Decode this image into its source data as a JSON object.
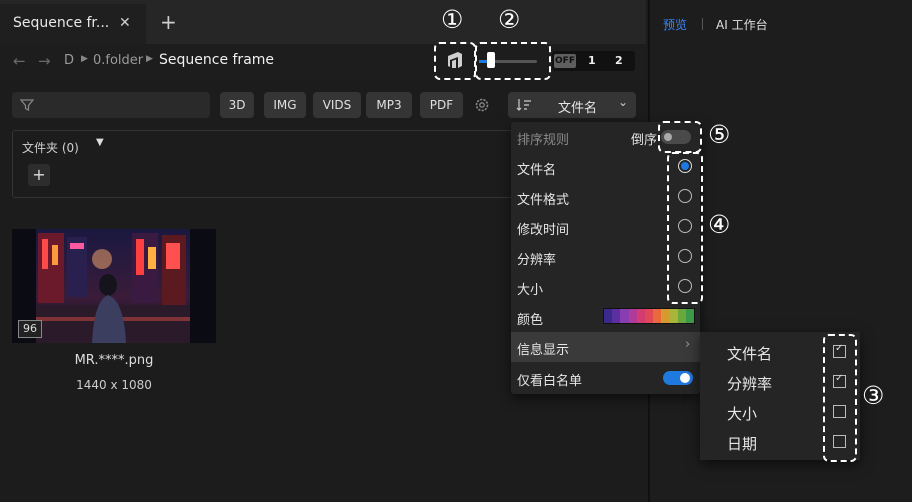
{
  "tab": {
    "title": "Sequence fr...",
    "close": "✕",
    "add": "+"
  },
  "path": {
    "back": "←",
    "forward": "→",
    "crumbs": [
      "D",
      "0.folder"
    ],
    "current": "Sequence frame"
  },
  "toggle": {
    "off": "OFF",
    "opt1": "1",
    "opt2": "2"
  },
  "filter_buttons": [
    "3D",
    "IMG",
    "VIDS",
    "MP3",
    "PDF"
  ],
  "sort": {
    "label": "文件名"
  },
  "folder": {
    "label": "文件夹 (0)",
    "add": "+"
  },
  "thumbnail": {
    "badge": "96",
    "name": "MR.****.png",
    "resolution": "1440 x 1080"
  },
  "right_panel": {
    "tab_preview": "预览",
    "tab_ai": "AI 工作台"
  },
  "dropdown": {
    "header": "排序规则",
    "reverse_label": "倒序",
    "reverse_on": false,
    "options": [
      "文件名",
      "文件格式",
      "修改时间",
      "分辨率",
      "大小"
    ],
    "selected_index": 0,
    "color_label": "颜色",
    "color_swatches": [
      "#3b2a8c",
      "#5a2fa0",
      "#8a3db0",
      "#b03a9a",
      "#d23c6e",
      "#e0485a",
      "#e86a3a",
      "#d89a30",
      "#a8b43a",
      "#6aa83a",
      "#3a9a4a"
    ],
    "info_label": "信息显示",
    "whitelist_label": "仅看白名单",
    "whitelist_on": true
  },
  "submenu": {
    "items": [
      {
        "label": "文件名",
        "checked": true
      },
      {
        "label": "分辨率",
        "checked": true
      },
      {
        "label": "大小",
        "checked": false
      },
      {
        "label": "日期",
        "checked": false
      }
    ]
  },
  "annotations": [
    "①",
    "②",
    "③",
    "④",
    "⑤"
  ],
  "colors": {
    "accent": "#1f7ae0",
    "preview_tab": "#3a86ff"
  }
}
